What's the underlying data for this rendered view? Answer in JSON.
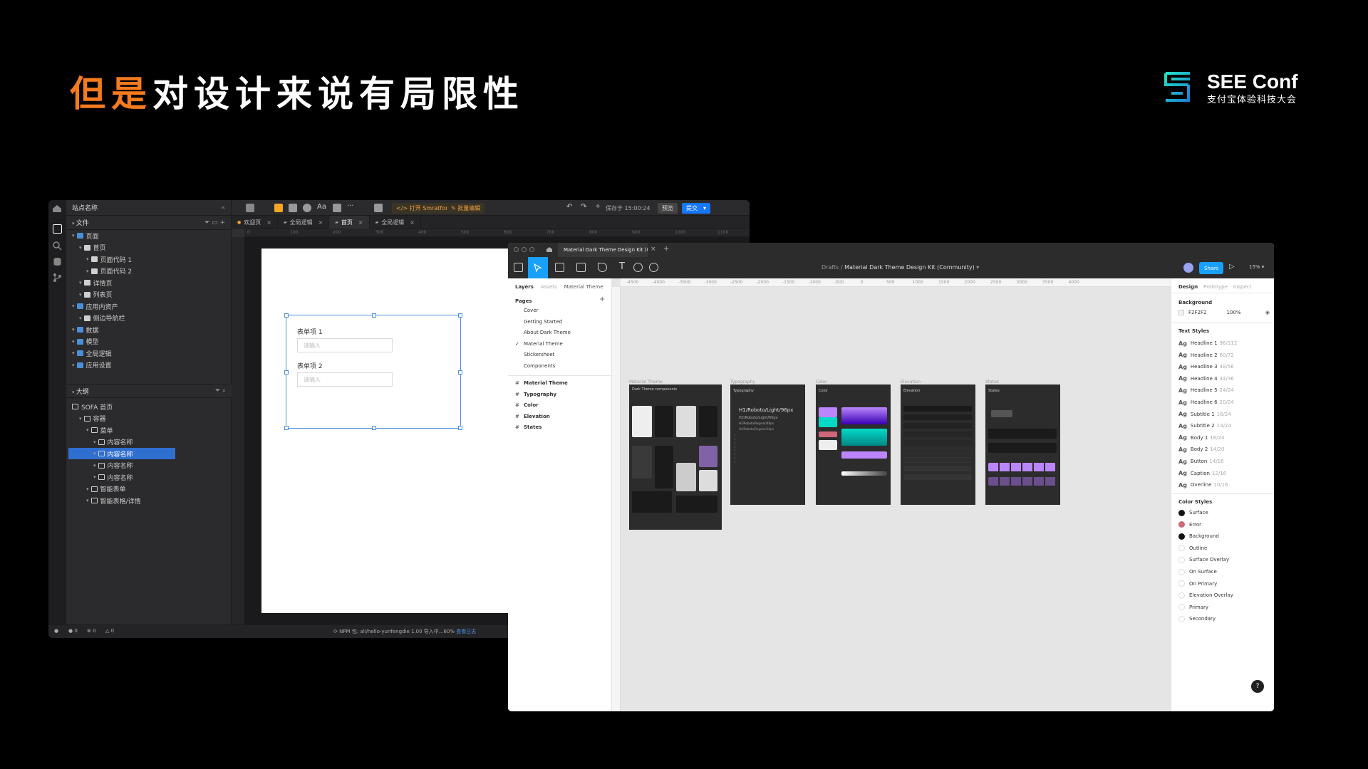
{
  "slide": {
    "title_highlight": "但是",
    "title_rest": "对设计来说有局限性",
    "logo_main": "SEE Conf",
    "logo_sub": "支付宝体验科技大会"
  },
  "editor": {
    "site_name": "站点名称",
    "files_label": "文件",
    "outline_label": "大纲",
    "open_smratform": "打开 Smratform",
    "batch_edit": "批量编辑",
    "saved_at": "保存于 15:00:24",
    "preview": "预览",
    "submit": "提交",
    "tabs": [
      "欢迎页",
      "全局逻辑",
      "首页",
      "全局逻辑"
    ],
    "active_tab": 2,
    "file_tree": [
      {
        "label": "页面",
        "indent": 0,
        "kind": "folder"
      },
      {
        "label": "首页",
        "indent": 1,
        "kind": "file"
      },
      {
        "label": "页面代码 1",
        "indent": 2,
        "kind": "file"
      },
      {
        "label": "页面代码 2",
        "indent": 2,
        "kind": "file"
      },
      {
        "label": "详情页",
        "indent": 1,
        "kind": "file"
      },
      {
        "label": "列表页",
        "indent": 1,
        "kind": "file"
      },
      {
        "label": "应用内资产",
        "indent": 0,
        "kind": "folder"
      },
      {
        "label": "侧边导航栏",
        "indent": 1,
        "kind": "file"
      },
      {
        "label": "数据",
        "indent": 0,
        "kind": "folder"
      },
      {
        "label": "模型",
        "indent": 0,
        "kind": "folder"
      },
      {
        "label": "全局逻辑",
        "indent": 0,
        "kind": "folder"
      },
      {
        "label": "应用设置",
        "indent": 0,
        "kind": "folder"
      }
    ],
    "outline_tree": [
      {
        "label": "SOFA 首页",
        "indent": 0
      },
      {
        "label": "容器",
        "indent": 1
      },
      {
        "label": "菜单",
        "indent": 2
      },
      {
        "label": "内容名称",
        "indent": 3
      },
      {
        "label": "内容名称",
        "indent": 3,
        "selected": true
      },
      {
        "label": "内容名称",
        "indent": 3
      },
      {
        "label": "内容名称",
        "indent": 3
      },
      {
        "label": "智能表单",
        "indent": 2
      },
      {
        "label": "智能表格/详情",
        "indent": 2
      }
    ],
    "ruler_ticks": [
      "0",
      "100",
      "200",
      "300",
      "400",
      "500",
      "600",
      "700",
      "800",
      "900",
      "1000",
      "1100"
    ],
    "form": {
      "item1_label": "表单项 1",
      "item1_placeholder": "请输入",
      "item2_label": "表单项 2",
      "item2_placeholder": "请输入"
    },
    "status_counts": [
      "0",
      "0",
      "0"
    ],
    "npm_status": "NPM 包: ali/hello-yunfengdie 1.00 导入中...60%",
    "npm_progress_percent": 60,
    "view_log": "查看日志"
  },
  "figma": {
    "file_tab": "Material Dark Theme Design Kit (Co...",
    "breadcrumb_drafts": "Drafts",
    "breadcrumb_file": "Material Dark Theme Design Kit (Community)",
    "share": "Share",
    "zoom": "15%",
    "left_tabs": [
      "Layers",
      "Assets",
      "Material Theme"
    ],
    "pages_label": "Pages",
    "pages": [
      "Cover",
      "Getting Started",
      "About Dark Theme",
      "Material Theme",
      "Stickersheet",
      "Components"
    ],
    "active_page": "Material Theme",
    "layers": [
      "Material Theme",
      "Typography",
      "Color",
      "Elevation",
      "States"
    ],
    "right_tabs": [
      "Design",
      "Prototype",
      "Inspect"
    ],
    "background_label": "Background",
    "background_hex": "F2F2F2",
    "background_opacity": "100%",
    "text_styles_label": "Text Styles",
    "text_styles": [
      {
        "name": "Headline 1",
        "spec": "96/112"
      },
      {
        "name": "Headline 2",
        "spec": "60/72"
      },
      {
        "name": "Headline 3",
        "spec": "48/56"
      },
      {
        "name": "Headline 4",
        "spec": "34/36"
      },
      {
        "name": "Headline 5",
        "spec": "24/24"
      },
      {
        "name": "Headline 6",
        "spec": "20/24"
      },
      {
        "name": "Subtitle 1",
        "spec": "16/24"
      },
      {
        "name": "Subtitle 2",
        "spec": "14/24"
      },
      {
        "name": "Body 1",
        "spec": "16/24"
      },
      {
        "name": "Body 2",
        "spec": "14/20"
      },
      {
        "name": "Button",
        "spec": "14/16"
      },
      {
        "name": "Caption",
        "spec": "12/16"
      },
      {
        "name": "Overline",
        "spec": "10/16"
      }
    ],
    "color_styles_label": "Color Styles",
    "color_styles": [
      {
        "name": "Surface",
        "color": "#121212"
      },
      {
        "name": "Error",
        "color": "#cf6679"
      },
      {
        "name": "Background",
        "color": "#121212"
      },
      {
        "name": "Outline",
        "color": "#ffffff"
      },
      {
        "name": "Surface Overlay",
        "color": "#ffffff"
      },
      {
        "name": "On Surface",
        "color": "#ffffff"
      },
      {
        "name": "On Primary",
        "color": "#ffffff"
      },
      {
        "name": "Elevation Overlay",
        "color": "#ffffff"
      },
      {
        "name": "Primary",
        "color": "#ffffff"
      },
      {
        "name": "Secondary",
        "color": "#ffffff"
      }
    ],
    "ruler_ticks": [
      "-4500",
      "-4000",
      "-3500",
      "-3000",
      "-2500",
      "-2000",
      "-1500",
      "-1000",
      "-500",
      "0",
      "500",
      "1000",
      "1500",
      "2000",
      "2500",
      "3000",
      "3500",
      "4000"
    ],
    "frames": [
      {
        "label": "Material Theme",
        "heading": "Dark Theme components"
      },
      {
        "label": "Typography",
        "heading": "Typography",
        "h1": "H1/Roboto/Light/96px",
        "h2": "H2/Roboto/Light/60px",
        "h3": "H3/Roboto/Regular/48px",
        "h4": "H4/Roboto/Regular/34px"
      },
      {
        "label": "Color",
        "heading": "Color"
      },
      {
        "label": "Elevation",
        "heading": "Elevation"
      },
      {
        "label": "States",
        "heading": "States"
      }
    ],
    "help": "?"
  },
  "colors": {
    "accent_orange": "#f57b1f",
    "figma_blue": "#18a0fb",
    "editor_select": "#2f6fd0",
    "purple": "#bb86fc",
    "teal": "#03dac6"
  }
}
